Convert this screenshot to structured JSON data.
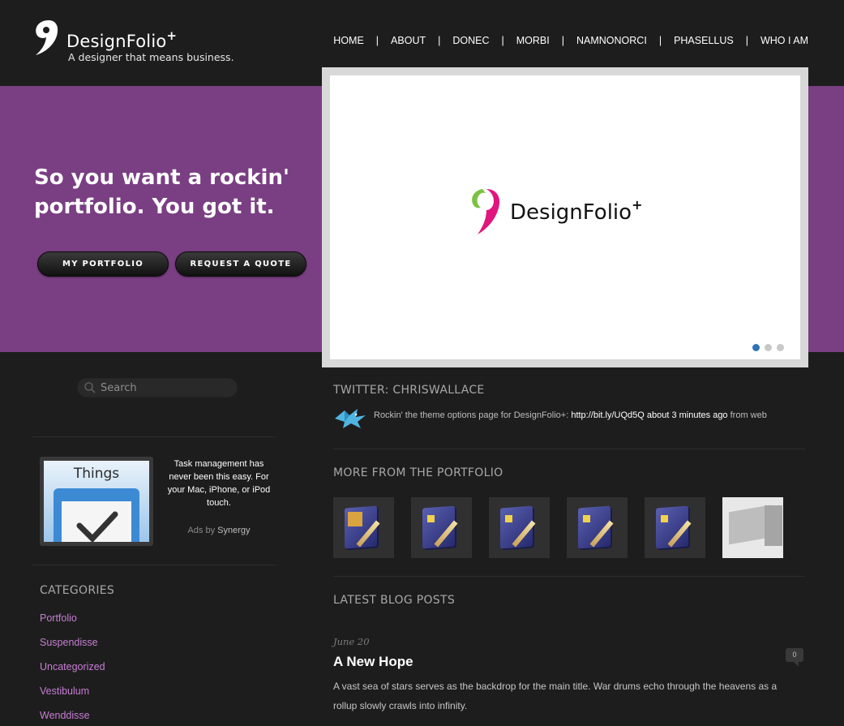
{
  "header": {
    "logo_name": "DesignFolio",
    "logo_plus": "+",
    "tagline": "A designer that means business."
  },
  "nav": {
    "items": [
      "HOME",
      "ABOUT",
      "DONEC",
      "MORBI",
      "NAMNONORCI",
      "PHASELLUS",
      "WHO I AM"
    ],
    "separator": "|"
  },
  "hero": {
    "title": "So you want a rockin' portfolio. You got it.",
    "btn_portfolio": "MY PORTFOLIO",
    "btn_quote": "REQUEST A QUOTE"
  },
  "slider": {
    "logo_name": "DesignFolio",
    "logo_plus": "+",
    "dot_count": 3,
    "active_dot": 0
  },
  "sidebar": {
    "search_placeholder": "Search",
    "ad": {
      "image_label": "Things",
      "text": "Task management has never been this easy. For your Mac, iPhone, or iPod touch.",
      "ads_by": "Ads by",
      "sponsor": "Synergy"
    },
    "categories_title": "CATEGORIES",
    "categories": [
      "Portfolio",
      "Suspendisse",
      "Uncategorized",
      "Vestibulum",
      "Wenddisse"
    ]
  },
  "twitter": {
    "title": "TWITTER: CHRISWALLACE",
    "text_before": "Rockin' the theme options page for DesignFolio+: ",
    "link": "http://bit.ly/UQd5Q",
    "time": " about 3 minutes ago",
    "source": " from web"
  },
  "portfolio": {
    "title": "MORE FROM THE PORTFOLIO",
    "thumb_count": 6
  },
  "blog": {
    "title": "LATEST BLOG POSTS",
    "post": {
      "date": "June 20",
      "title": "A New Hope",
      "comments": "0",
      "excerpt": "A vast sea of stars serves as the backdrop for the main title. War drums echo through the heavens as a rollup slowly crawls into infinity."
    }
  },
  "colors": {
    "hero_bg": "#7a3e83",
    "page_bg": "#1e1d1e",
    "category_link": "#c57ed2",
    "active_dot": "#2f73b6",
    "logo_green": "#7cc242",
    "logo_pink": "#e0157d"
  }
}
